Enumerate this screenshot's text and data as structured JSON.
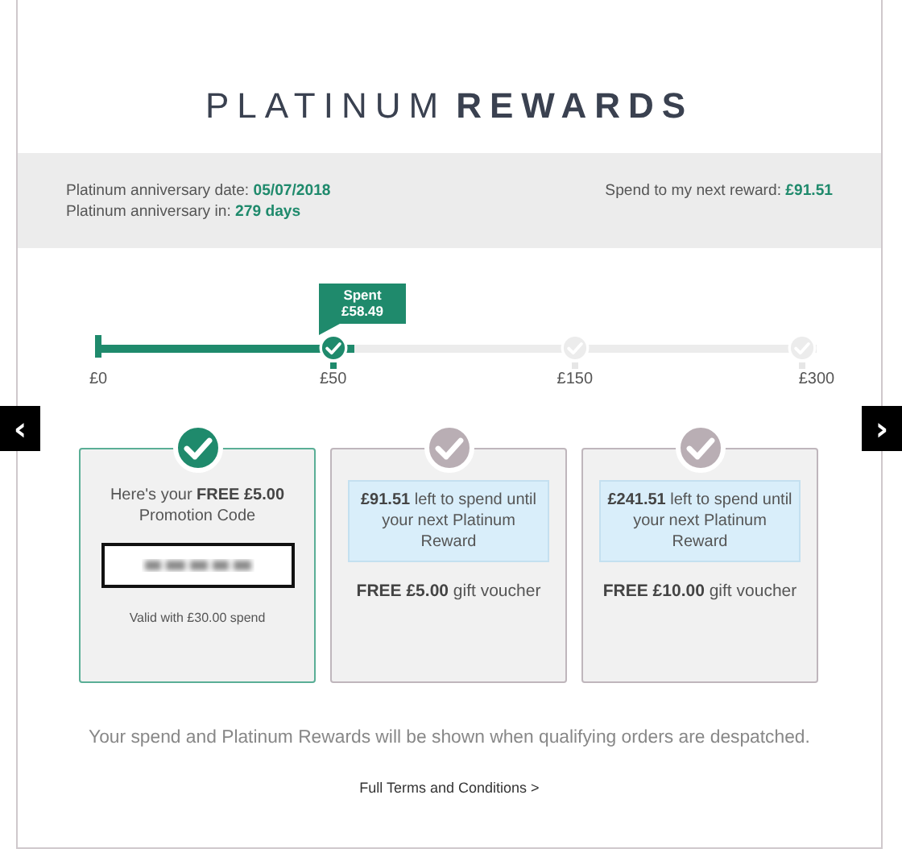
{
  "title": {
    "light": "PLATINUM",
    "bold": "REWARDS"
  },
  "summary": {
    "anniversary_date": "Platinum anniversary date: **05/07/2018**",
    "anniversary_in": "Platinum anniversary in: **279 days**",
    "next_reward": "Spend to my next reward: **£91.51**"
  },
  "progress": {
    "level": 0.36,
    "spent_label": "Spent",
    "spent_value": "£58.49",
    "milestones": [
      {
        "kind": "start",
        "label": "£0",
        "reached": true
      },
      {
        "kind": "check",
        "label": "£50",
        "reached": true
      },
      {
        "kind": "check",
        "label": "£150",
        "reached": false
      },
      {
        "kind": "check",
        "label": "£300",
        "reached": false
      }
    ]
  },
  "carousel": {
    "prev": "‹",
    "next": "›"
  },
  "cards": [
    {
      "kind": "promo",
      "reached": true,
      "text": "Here's your **FREE £5.00** Promotion Code",
      "note": "Valid with £30.00 spend"
    },
    {
      "kind": "locked",
      "reached": false,
      "notice": "**£91.51** left to spend until your next Platinum Reward",
      "reward": "**FREE £5.00** gift voucher"
    },
    {
      "kind": "locked",
      "reached": false,
      "notice": "**£241.51** left to spend until your next Platinum Reward",
      "reward": "**FREE £10.00** gift voucher"
    }
  ],
  "footer_note": "Your spend and Platinum Rewards will be shown when qualifying orders are despatched.",
  "terms_link": "Full Terms and Conditions >"
}
